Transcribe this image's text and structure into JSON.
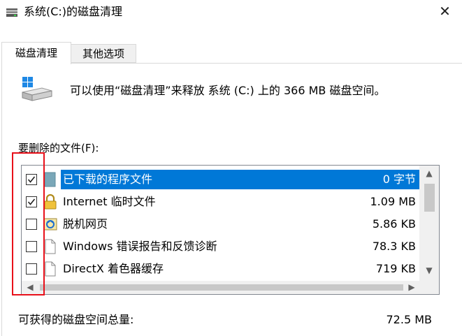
{
  "window": {
    "title": "系统(C:)的磁盘清理",
    "close_icon": "close-icon",
    "title_icon": "disk-cleanup-icon"
  },
  "tabs": [
    {
      "label": "磁盘清理",
      "active": true
    },
    {
      "label": "其他选项",
      "active": false
    }
  ],
  "main": {
    "description": "可以使用“磁盘清理”来释放 系统 (C:) 上的 366 MB 磁盘空间。",
    "files_label": "要删除的文件(F):",
    "files": [
      {
        "label": "已下载的程序文件",
        "size": "0 字节",
        "checked": true,
        "selected": true,
        "icon": "folder-icon"
      },
      {
        "label": "Internet 临时文件",
        "size": "1.09 MB",
        "checked": true,
        "selected": false,
        "icon": "lock-icon"
      },
      {
        "label": "脱机网页",
        "size": "5.86 KB",
        "checked": false,
        "selected": false,
        "icon": "offline-webpage-icon"
      },
      {
        "label": "Windows 错误报告和反馈诊断",
        "size": "78.3 KB",
        "checked": false,
        "selected": false,
        "icon": "document-icon"
      },
      {
        "label": "DirectX 着色器缓存",
        "size": "719 KB",
        "checked": false,
        "selected": false,
        "icon": "document-icon"
      }
    ],
    "total_label": "可获得的磁盘空间总量:",
    "total_value": "72.5 MB"
  },
  "colors": {
    "selection": "#0078d7",
    "highlight_box": "#e8101a"
  }
}
